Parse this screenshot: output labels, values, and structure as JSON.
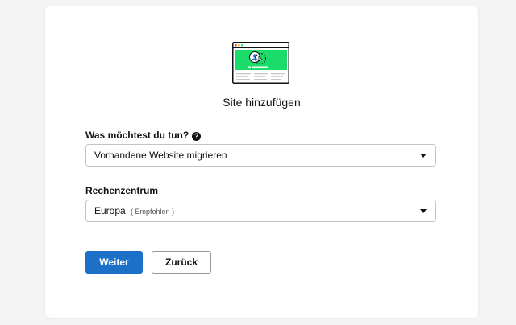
{
  "dialog": {
    "title": "Site hinzufügen",
    "illustration": "website-migration-illustration"
  },
  "fields": {
    "purpose": {
      "label": "Was möchtest du tun?",
      "help_icon": "question-circle-icon",
      "value": "Vorhandene Website migrieren"
    },
    "datacenter": {
      "label": "Rechenzentrum",
      "value": "Europa",
      "hint": "( Empfohlen )"
    }
  },
  "buttons": {
    "next_label": "Weiter",
    "back_label": "Zurück"
  },
  "colors": {
    "accent": "#1d70c8",
    "illustration_green": "#1bdb6a",
    "page_background": "#f4f4f4"
  }
}
